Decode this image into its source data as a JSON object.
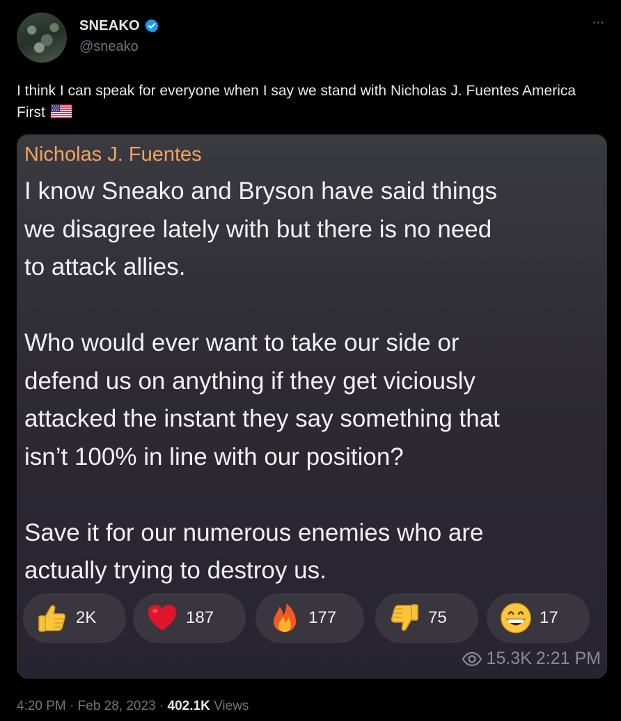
{
  "author": {
    "display_name": "SNEAKO",
    "handle": "@sneako",
    "verified": true,
    "avatar_icon": "avatar-photo"
  },
  "more_icon": "more-horizontal-icon",
  "more_glyph": "···",
  "tweet": {
    "text": "I think I can speak for everyone when I say we stand with Nicholas J. Fuentes America First",
    "flag_icon": "us-flag-emoji"
  },
  "embed": {
    "author": "Nicholas J. Fuentes",
    "body": "I know Sneako and Bryson have said things\nwe disagree lately with but there is no need\nto attack allies.\n\nWho would ever want to take our side or\ndefend us on anything if they get viciously\nattacked the instant they say something that\nisn’t 100% in line with our position?\n\nSave it for our numerous enemies who are\nactually trying to destroy us.",
    "reactions": [
      {
        "icon": "thumbs-up-emoji",
        "count": "2K"
      },
      {
        "icon": "red-heart-emoji",
        "count": "187"
      },
      {
        "icon": "fire-emoji",
        "count": "177"
      },
      {
        "icon": "thumbs-down-emoji",
        "count": "75"
      },
      {
        "icon": "grinning-face-emoji",
        "count": "17"
      }
    ],
    "views": "15.3K",
    "time": "2:21 PM",
    "views_icon": "eye-icon"
  },
  "footer": {
    "time": "4:20 PM",
    "separator": "·",
    "date": "Feb 28, 2023",
    "views_count": "402.1K",
    "views_label": "Views"
  },
  "colors": {
    "background": "#000000",
    "text": "#e7e9ea",
    "muted": "#71767b",
    "verified_blue": "#1d9bf0",
    "embed_author": "#f2a35e",
    "embed_bg": "#2d2a33",
    "reaction_bg": "#39363f"
  }
}
